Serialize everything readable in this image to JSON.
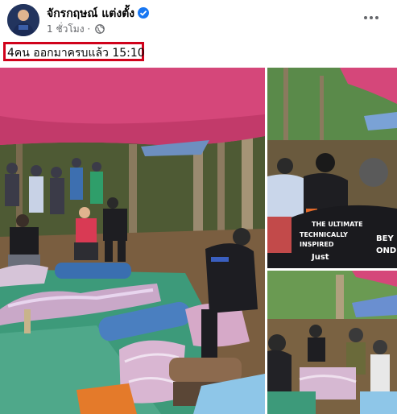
{
  "post": {
    "author": "จักรกฤษณ์ แต่งตั้ง",
    "timestamp": "1 ชั่วโมง",
    "caption": "4คน ออกมาครบแล้ว 15:10",
    "verified_icon": "verified-badge-icon",
    "privacy_icon": "globe-icon",
    "menu_icon": "more-options-icon"
  },
  "photos": {
    "p2_shirt_line1": "THE ULTIMATE",
    "p2_shirt_line2": "TECHNICALLY",
    "p2_shirt_line3": "INSPIRED",
    "p2_shirt_line4": "Just",
    "p2_shirt_line5": "BEY",
    "p2_shirt_line6": "OND"
  },
  "colors": {
    "highlight_border": "#d0021b",
    "verified": "#1877f2",
    "tarp": "#d94b7a"
  }
}
